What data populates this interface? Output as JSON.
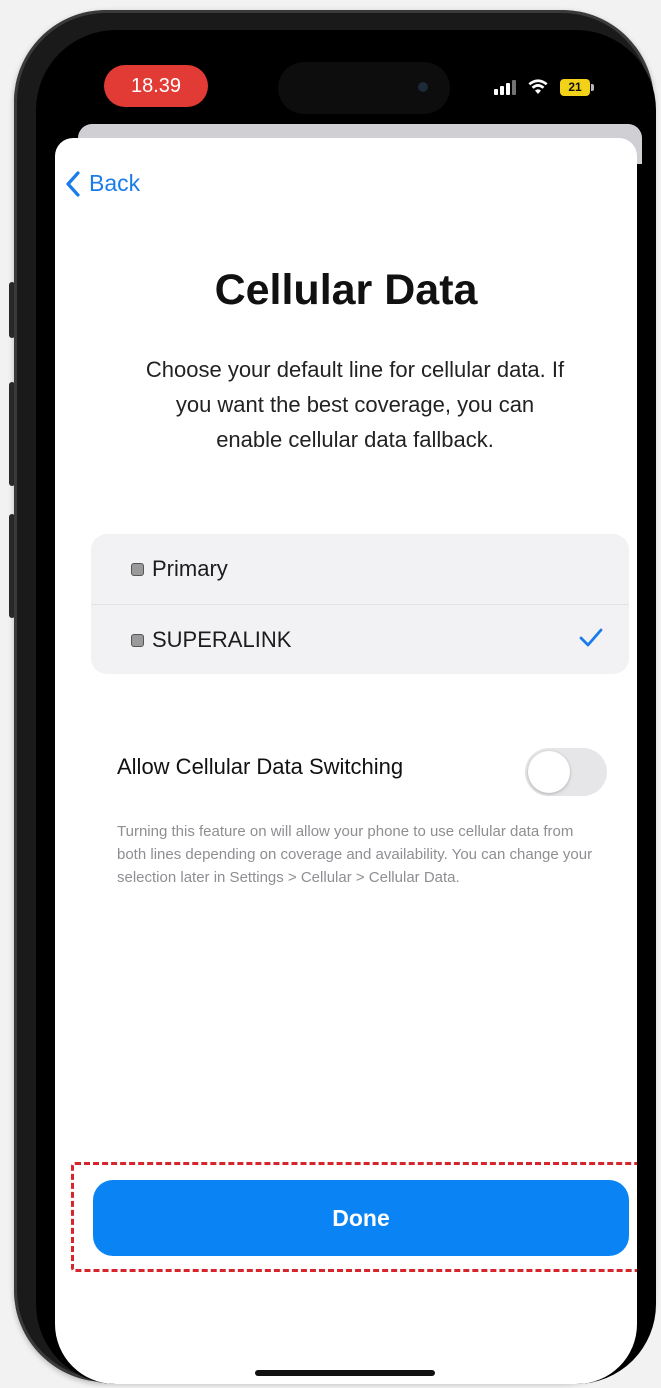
{
  "status_bar": {
    "time": "18.39",
    "battery_level": "21",
    "time_pill_color": "#e23b36",
    "battery_color": "#f2d219"
  },
  "nav": {
    "back_label": "Back",
    "back_icon": "chevron-left-icon"
  },
  "main": {
    "title": "Cellular Data",
    "description": "Choose your default line for cellular data. If you want the best coverage, you can enable cellular data fallback.",
    "lines": [
      {
        "label": "Primary",
        "selected": false,
        "icon": "sim-icon"
      },
      {
        "label": "SUPERALINK",
        "selected": true,
        "icon": "sim-icon"
      }
    ],
    "switch": {
      "label": "Allow Cellular Data Switching",
      "enabled": false
    },
    "footnote": "Turning this feature on will allow your phone to use cellular data from both lines depending on coverage and availability. You can change your selection later in Settings > Cellular > Cellular Data."
  },
  "footer": {
    "done_label": "Done"
  },
  "colors": {
    "accent": "#0a84f5",
    "link": "#1a7ce8",
    "highlight": "#d7262b"
  }
}
